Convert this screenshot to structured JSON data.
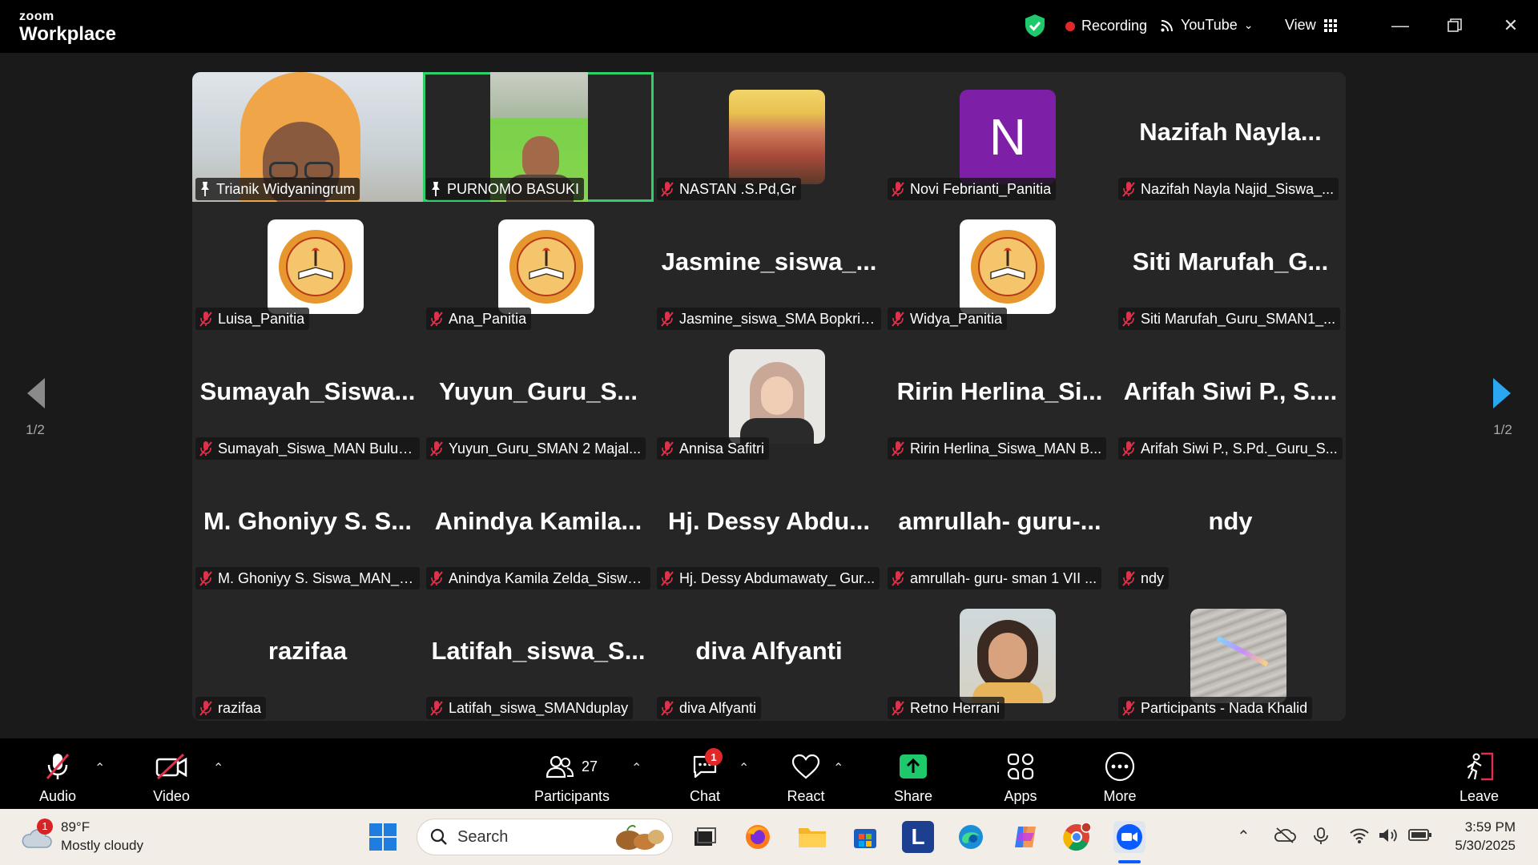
{
  "app": {
    "brand_top": "zoom",
    "brand_bottom": "Workplace"
  },
  "titlebar": {
    "recording_label": "Recording",
    "stream_label": "YouTube",
    "view_label": "View"
  },
  "pagination": {
    "left": "1/2",
    "right": "1/2"
  },
  "participants_grid": [
    {
      "name": "Trianik Widyaningrum",
      "big": "",
      "muted": false,
      "pinned": true,
      "media": "video"
    },
    {
      "name": "PURNOMO BASUKI",
      "big": "",
      "muted": false,
      "pinned": true,
      "media": "video-green",
      "selected": true
    },
    {
      "name": "NASTAN .S.Pd,Gr",
      "big": "",
      "muted": true,
      "pinned": false,
      "media": "photo-group"
    },
    {
      "name": "Novi Febrianti_Panitia",
      "big": "",
      "muted": true,
      "pinned": false,
      "media": "letter",
      "letter": "N"
    },
    {
      "name": "Nazifah Nayla Najid_Siswa_...",
      "big": "Nazifah  Nayla...",
      "muted": true,
      "pinned": false,
      "media": "none"
    },
    {
      "name": "Luisa_Panitia",
      "big": "",
      "muted": true,
      "pinned": false,
      "media": "logo"
    },
    {
      "name": "Ana_Panitia",
      "big": "",
      "muted": true,
      "pinned": false,
      "media": "logo"
    },
    {
      "name": "Jasmine_siswa_SMA Bopkri ...",
      "big": "Jasmine_siswa_...",
      "muted": true,
      "pinned": false,
      "media": "none"
    },
    {
      "name": "Widya_Panitia",
      "big": "",
      "muted": true,
      "pinned": false,
      "media": "logo"
    },
    {
      "name": "Siti Marufah_Guru_SMAN1_...",
      "big": "Siti  Marufah_G...",
      "muted": true,
      "pinned": false,
      "media": "none"
    },
    {
      "name": "Sumayah_Siswa_MAN Bulun...",
      "big": "Sumayah_Siswa...",
      "muted": true,
      "pinned": false,
      "media": "none"
    },
    {
      "name": "Yuyun_Guru_SMAN 2 Majal...",
      "big": "Yuyun_Guru_S...",
      "muted": true,
      "pinned": false,
      "media": "none"
    },
    {
      "name": "Annisa Safitri",
      "big": "",
      "muted": true,
      "pinned": false,
      "media": "photo-hijab"
    },
    {
      "name": "Ririn Herlina_Siswa_MAN B...",
      "big": "Ririn  Herlina_Si...",
      "muted": true,
      "pinned": false,
      "media": "none"
    },
    {
      "name": "Arifah Siwi P., S.Pd._Guru_S...",
      "big": "Arifah  Siwi  P.,  S....",
      "muted": true,
      "pinned": false,
      "media": "none"
    },
    {
      "name": "M. Ghoniyy S. Siswa_MAN_B...",
      "big": "M.  Ghoniyy  S.  S...",
      "muted": true,
      "pinned": false,
      "media": "none"
    },
    {
      "name": "Anindya Kamila Zelda_Siswa...",
      "big": "Anindya  Kamila...",
      "muted": true,
      "pinned": false,
      "media": "none"
    },
    {
      "name": "Hj. Dessy Abdumawaty_ Gur...",
      "big": "Hj.  Dessy  Abdu...",
      "muted": true,
      "pinned": false,
      "media": "none"
    },
    {
      "name": "amrullah- guru- sman 1 VII ...",
      "big": "amrullah-  guru-...",
      "muted": true,
      "pinned": false,
      "media": "none"
    },
    {
      "name": "ndy",
      "big": "ndy",
      "muted": true,
      "pinned": false,
      "media": "none"
    },
    {
      "name": "razifaa",
      "big": "razifaa",
      "muted": true,
      "pinned": false,
      "media": "none"
    },
    {
      "name": "Latifah_siswa_SMANduplay",
      "big": "Latifah_siswa_S...",
      "muted": true,
      "pinned": false,
      "media": "none"
    },
    {
      "name": "diva Alfyanti",
      "big": "diva Alfyanti",
      "muted": true,
      "pinned": false,
      "media": "none"
    },
    {
      "name": "Retno Herrani",
      "big": "",
      "muted": true,
      "pinned": false,
      "media": "photo-girl"
    },
    {
      "name": "Participants - Nada Khalid",
      "big": "",
      "muted": true,
      "pinned": false,
      "media": "photo-gray"
    }
  ],
  "toolbar": {
    "audio": "Audio",
    "video": "Video",
    "participants": "Participants",
    "participants_count": "27",
    "chat": "Chat",
    "chat_badge": "1",
    "react": "React",
    "share": "Share",
    "apps": "Apps",
    "more": "More",
    "leave": "Leave"
  },
  "taskbar": {
    "weather_badge": "1",
    "temperature": "89°F",
    "condition": "Mostly cloudy",
    "search_placeholder": "Search",
    "time": "3:59 PM",
    "date": "5/30/2025"
  },
  "colors": {
    "selected_outline": "#2fd06a",
    "muted_red": "#e0304a",
    "share_green": "#1ec96b",
    "nav_arrow_blue": "#2aa7f0"
  }
}
